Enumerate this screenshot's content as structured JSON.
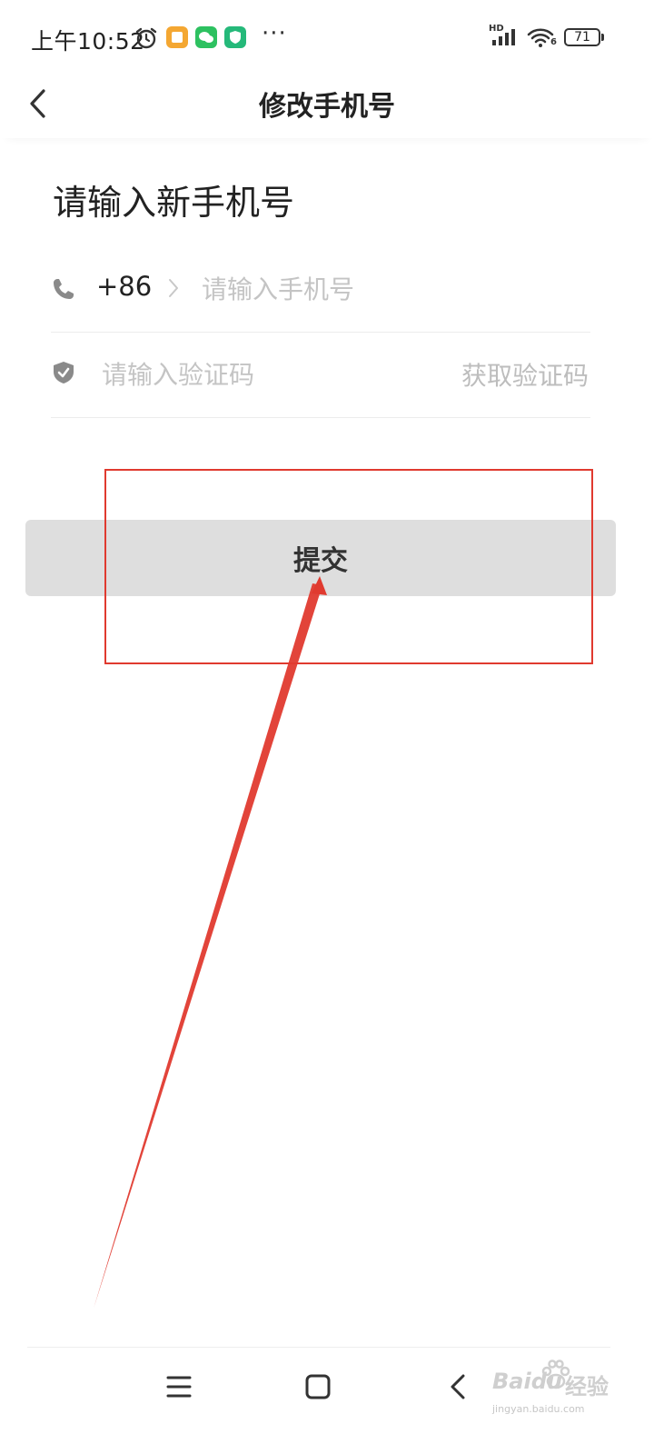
{
  "status_bar": {
    "time": "上午10:52",
    "network_label": "HD",
    "wifi_label": "6",
    "battery_level": "71",
    "more_label": "···"
  },
  "header": {
    "title": "修改手机号"
  },
  "form": {
    "heading": "请输入新手机号",
    "country_code": "+86",
    "phone_placeholder": "请输入手机号",
    "code_placeholder": "请输入验证码",
    "get_code_label": "获取验证码",
    "submit_label": "提交"
  },
  "colors": {
    "annotation": "#e03a2f",
    "button_bg": "#dedede",
    "placeholder": "#c4c4c4"
  },
  "watermark": {
    "brand": "Baidu",
    "brand_suffix": "经验",
    "url": "jingyan.baidu.com"
  }
}
